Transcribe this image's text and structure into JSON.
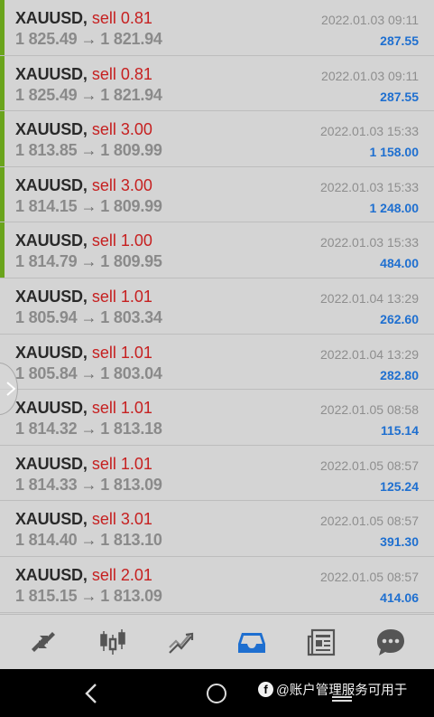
{
  "trades": [
    {
      "symbol": "XAUUSD",
      "side": "sell 0.81",
      "prices": {
        "open": "1 825.49",
        "close": "1 821.94"
      },
      "date": "2022.01.03 09:11",
      "profit": "287.55",
      "marked": true
    },
    {
      "symbol": "XAUUSD",
      "side": "sell 0.81",
      "prices": {
        "open": "1 825.49",
        "close": "1 821.94"
      },
      "date": "2022.01.03 09:11",
      "profit": "287.55",
      "marked": true
    },
    {
      "symbol": "XAUUSD",
      "side": "sell 3.00",
      "prices": {
        "open": "1 813.85",
        "close": "1 809.99"
      },
      "date": "2022.01.03 15:33",
      "profit": "1 158.00",
      "marked": true
    },
    {
      "symbol": "XAUUSD",
      "side": "sell 3.00",
      "prices": {
        "open": "1 814.15",
        "close": "1 809.99"
      },
      "date": "2022.01.03 15:33",
      "profit": "1 248.00",
      "marked": true
    },
    {
      "symbol": "XAUUSD",
      "side": "sell 1.00",
      "prices": {
        "open": "1 814.79",
        "close": "1 809.95"
      },
      "date": "2022.01.03 15:33",
      "profit": "484.00",
      "marked": true
    },
    {
      "symbol": "XAUUSD",
      "side": "sell 1.01",
      "prices": {
        "open": "1 805.94",
        "close": "1 803.34"
      },
      "date": "2022.01.04 13:29",
      "profit": "262.60",
      "marked": false
    },
    {
      "symbol": "XAUUSD",
      "side": "sell 1.01",
      "prices": {
        "open": "1 805.84",
        "close": "1 803.04"
      },
      "date": "2022.01.04 13:29",
      "profit": "282.80",
      "marked": false
    },
    {
      "symbol": "XAUUSD",
      "side": "sell 1.01",
      "prices": {
        "open": "1 814.32",
        "close": "1 813.18"
      },
      "date": "2022.01.05 08:58",
      "profit": "115.14",
      "marked": false
    },
    {
      "symbol": "XAUUSD",
      "side": "sell 1.01",
      "prices": {
        "open": "1 814.33",
        "close": "1 813.09"
      },
      "date": "2022.01.05 08:57",
      "profit": "125.24",
      "marked": false
    },
    {
      "symbol": "XAUUSD",
      "side": "sell 3.01",
      "prices": {
        "open": "1 814.40",
        "close": "1 813.10"
      },
      "date": "2022.01.05 08:57",
      "profit": "391.30",
      "marked": false
    },
    {
      "symbol": "XAUUSD",
      "side": "sell 2.01",
      "prices": {
        "open": "1 815.15",
        "close": "1 813.09"
      },
      "date": "2022.01.05 08:57",
      "profit": "414.06",
      "marked": false
    }
  ],
  "colors": {
    "sell": "#c62020",
    "profit": "#1e6fd0",
    "marker": "#6aa41c",
    "toolbar_icon": "#555555",
    "toolbar_icon_active": "#1e6fd0"
  },
  "toolbar": {
    "items": [
      {
        "icon": "trade-arrows-icon",
        "active": false
      },
      {
        "icon": "candlestick-chart-icon",
        "active": false
      },
      {
        "icon": "trend-chart-icon",
        "active": false
      },
      {
        "icon": "history-inbox-icon",
        "active": true
      },
      {
        "icon": "news-icon",
        "active": false
      },
      {
        "icon": "chat-bubble-icon",
        "active": false
      }
    ]
  },
  "navbar": {
    "watermark_text": "@账户管理服务可用于"
  }
}
